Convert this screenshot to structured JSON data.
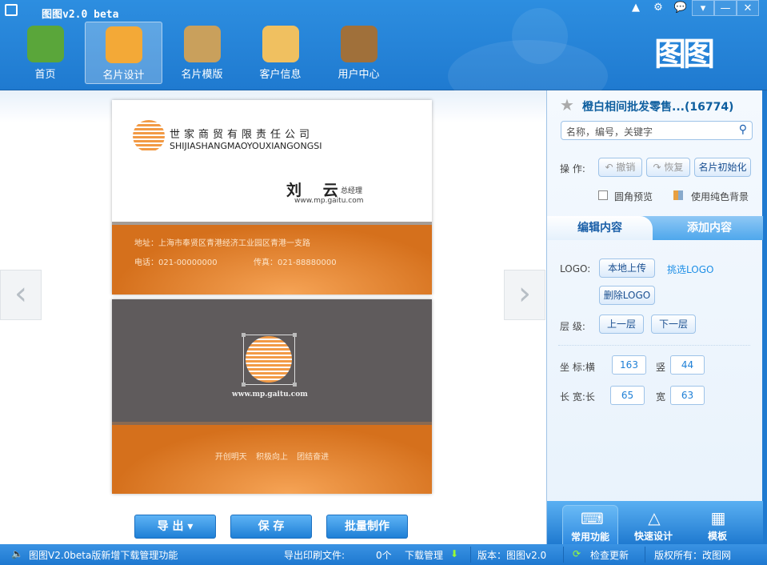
{
  "window": {
    "title": "图图v2.0 beta",
    "buttons": [
      "▲",
      "⚙",
      "💬",
      "▾",
      "—",
      "✕"
    ]
  },
  "nav": [
    {
      "label": "首页",
      "color": "#5aa63a"
    },
    {
      "label": "名片设计",
      "color": "#f3a937"
    },
    {
      "label": "名片模版",
      "color": "#c9a05c"
    },
    {
      "label": "客户信息",
      "color": "#f0c060"
    },
    {
      "label": "用户中心",
      "color": "#a0703a"
    }
  ],
  "brand_logo": "图图",
  "card_front": {
    "company_cn": "世家商贸有限责任公司",
    "company_en": "SHIJIASHANGMAOYOUXIANGONGSI",
    "name": "刘 云",
    "title": "总经理",
    "website": "www.mp.gaitu.com",
    "address": "地址：上海市奉贤区青港经济工业园区青港一支路",
    "phone": "电话：021-00000000",
    "fax": "传真：021-88880000"
  },
  "card_back": {
    "website": "www.mp.gaitu.com",
    "slogan": "开创明天 积极向上 团结奋进"
  },
  "actions": {
    "export": "导 出",
    "save": "保 存",
    "batch": "批量制作"
  },
  "side": {
    "template_name": "橙白相间批发零售...(16774)",
    "search_placeholder": "名称，编号，关键字",
    "ops_label": "操  作:",
    "undo": "撤销",
    "redo": "恢复",
    "reset": "名片初始化",
    "rounded_preview": "圆角预览",
    "solid_bg": "使用纯色背景",
    "tabs": [
      "编辑内容",
      "添加内容"
    ],
    "logo_label": "LOGO:",
    "upload": "本地上传",
    "pick_logo": "挑选LOGO",
    "delete_logo": "删除LOGO",
    "layer_label": "层  级:",
    "layer_up": "上一层",
    "layer_down": "下一层",
    "coord_label": "坐  标:横",
    "x_value": "163",
    "y_label": "竖",
    "y_value": "44",
    "size_label": "长  宽:长",
    "w_value": "65",
    "h_label": "宽",
    "h_value": "63",
    "bottom_tabs": [
      "常用功能",
      "快速设计",
      "模板"
    ]
  },
  "status": {
    "news": "图图V2.0beta版新增下载管理功能",
    "export_files": "导出印刷文件:",
    "count": "0个",
    "download": "下载管理",
    "version": "版本：图图v2.0",
    "check_update": "检查更新",
    "copyright": "版权所有：改图网"
  }
}
